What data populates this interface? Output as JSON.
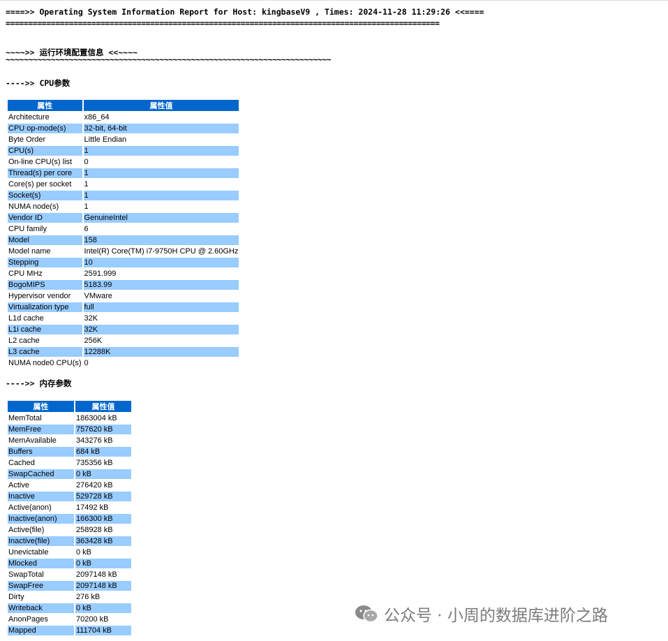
{
  "report": {
    "header_line": "====>> Operating System Information Report for Host: kingbaseV9 , Times: 2024-11-28 11:29:26 <<====",
    "header_rule": "================================================================================================",
    "section_title": "~~~~>> 运行环境配置信息 <<~~~~",
    "section_rule": "~~~~~~~~~~~~~~~~~~~~~~~~~~~~~~~~~~~~~~~~~~~~~~~~~~~~~~~~~~~~~~~~~~~~~~~~",
    "cpu_heading": "---->> CPU参数",
    "mem_heading": "---->> 内存参数"
  },
  "cpu_table": {
    "headers": [
      "属性",
      "属性值"
    ],
    "rows": [
      [
        "Architecture",
        "x86_64"
      ],
      [
        "CPU op-mode(s)",
        "32-bit, 64-bit"
      ],
      [
        "Byte Order",
        "Little Endian"
      ],
      [
        "CPU(s)",
        "1"
      ],
      [
        "On-line CPU(s) list",
        "0"
      ],
      [
        "Thread(s) per core",
        "1"
      ],
      [
        "Core(s) per socket",
        "1"
      ],
      [
        "Socket(s)",
        "1"
      ],
      [
        "NUMA node(s)",
        "1"
      ],
      [
        "Vendor ID",
        "GenuineIntel"
      ],
      [
        "CPU family",
        "6"
      ],
      [
        "Model",
        "158"
      ],
      [
        "Model name",
        "Intel(R) Core(TM) i7-9750H CPU @ 2.60GHz"
      ],
      [
        "Stepping",
        "10"
      ],
      [
        "CPU MHz",
        "2591.999"
      ],
      [
        "BogoMIPS",
        "5183.99"
      ],
      [
        "Hypervisor vendor",
        "VMware"
      ],
      [
        "Virtualization type",
        "full"
      ],
      [
        "L1d cache",
        "32K"
      ],
      [
        "L1i cache",
        "32K"
      ],
      [
        "L2 cache",
        "256K"
      ],
      [
        "L3 cache",
        "12288K"
      ],
      [
        "NUMA node0 CPU(s)",
        "0"
      ]
    ]
  },
  "mem_table": {
    "headers": [
      "属性",
      "属性值"
    ],
    "rows": [
      [
        "MemTotal",
        "1863004 kB"
      ],
      [
        "MemFree",
        "757620 kB"
      ],
      [
        "MemAvailable",
        "343276 kB"
      ],
      [
        "Buffers",
        "684 kB"
      ],
      [
        "Cached",
        "735356 kB"
      ],
      [
        "SwapCached",
        "0 kB"
      ],
      [
        "Active",
        "276420 kB"
      ],
      [
        "Inactive",
        "529728 kB"
      ],
      [
        "Active(anon)",
        "17492 kB"
      ],
      [
        "Inactive(anon)",
        "166300 kB"
      ],
      [
        "Active(file)",
        "258928 kB"
      ],
      [
        "Inactive(file)",
        "363428 kB"
      ],
      [
        "Unevictable",
        "0 kB"
      ],
      [
        "Mlocked",
        "0 kB"
      ],
      [
        "SwapTotal",
        "2097148 kB"
      ],
      [
        "SwapFree",
        "2097148 kB"
      ],
      [
        "Dirty",
        "276 kB"
      ],
      [
        "Writeback",
        "0 kB"
      ],
      [
        "AnonPages",
        "70200 kB"
      ],
      [
        "Mapped",
        "111704 kB"
      ]
    ]
  },
  "watermark": {
    "text": "公众号 · 小周的数据库进阶之路",
    "icon": "wechat-icon"
  },
  "colors": {
    "header_bg": "#0066cc",
    "alt_row_bg": "#99ccff",
    "watermark": "#7b7b7b"
  }
}
